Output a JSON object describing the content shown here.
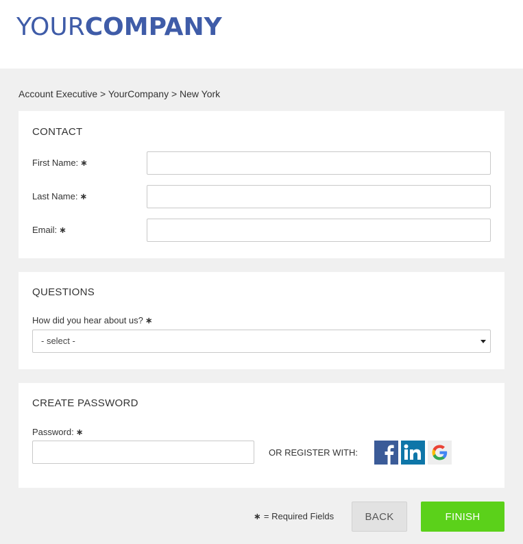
{
  "header": {
    "logo_light": "YOUR",
    "logo_bold": "COMPANY"
  },
  "breadcrumb": "Account Executive > YourCompany > New York",
  "contact": {
    "title": "CONTACT",
    "first_name_label": "First Name:",
    "last_name_label": "Last Name:",
    "email_label": "Email:",
    "first_name_value": "",
    "last_name_value": "",
    "email_value": ""
  },
  "questions": {
    "title": "QUESTIONS",
    "hear_label": "How did you hear about us?",
    "select_value": "- select -"
  },
  "password": {
    "title": "CREATE PASSWORD",
    "label": "Password:",
    "value": "",
    "or_register": "OR REGISTER WITH:",
    "social": [
      "facebook-icon",
      "linkedin-icon",
      "google-icon"
    ]
  },
  "required_marker": "∗",
  "required_note": "= Required Fields",
  "buttons": {
    "back": "BACK",
    "finish": "FINISH"
  },
  "colors": {
    "brand": "#3f5ca8",
    "finish": "#5bd11a",
    "facebook": "#3b5b98",
    "linkedin": "#0e76a8"
  }
}
